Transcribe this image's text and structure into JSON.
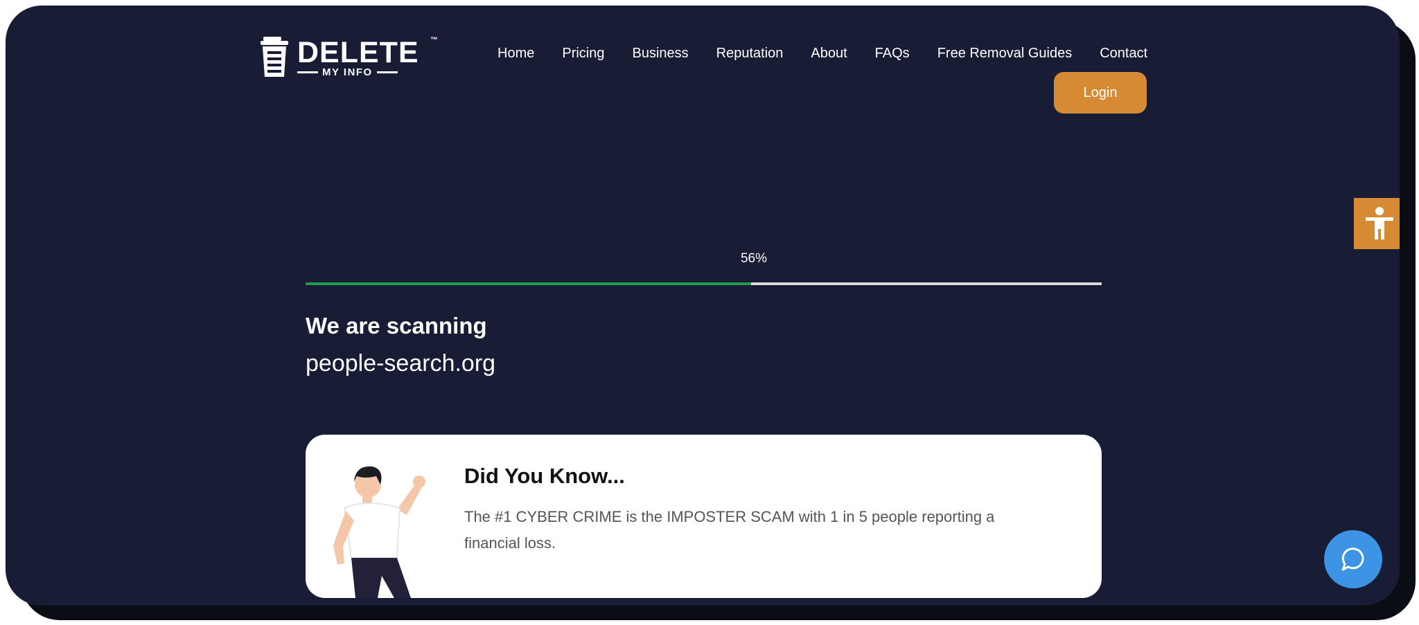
{
  "brand": {
    "name": "DELETE",
    "sub": "MY INFO",
    "tm": "™"
  },
  "nav": {
    "items": [
      "Home",
      "Pricing",
      "Business",
      "Reputation",
      "About",
      "FAQs",
      "Free Removal Guides",
      "Contact"
    ],
    "login_label": "Login"
  },
  "scan": {
    "progress": 56,
    "progress_label": "56%",
    "title": "We are scanning",
    "domain": "people-search.org"
  },
  "card": {
    "title": "Did You Know...",
    "text": "The #1 CYBER CRIME is the IMPOSTER SCAM with 1 in 5 people reporting a financial loss."
  },
  "colors": {
    "background": "#181c35",
    "accent": "#d68a33",
    "progress_fill": "#1f9b4a",
    "chat": "#3d93e4"
  },
  "icons": {
    "logo": "trash-can-icon",
    "accessibility": "accessibility-icon",
    "chat": "chat-bubble-icon"
  }
}
